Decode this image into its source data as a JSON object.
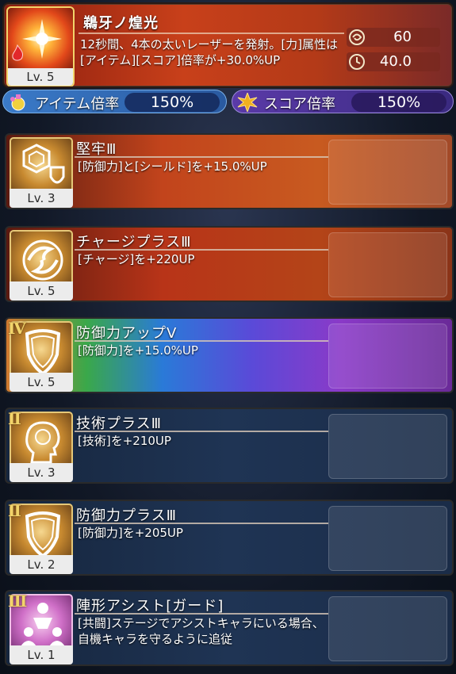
{
  "main_skill": {
    "title": "鵜牙ノ煌光",
    "level": "Lv. 5",
    "description": "12秒間、4本の太いレーザーを発射。[力]属性は[アイテム][スコア]倍率が+30.0%UP",
    "stat_charge": "60",
    "stat_time": "40.0",
    "icon": "flare-icon"
  },
  "multipliers": {
    "item_label": "アイテム倍率",
    "item_value": "150%",
    "score_label": "スコア倍率",
    "score_value": "150%"
  },
  "skills": [
    {
      "roman": "",
      "title": "堅牢Ⅲ",
      "desc": "[防御力]と[シールド]を+15.0%UP",
      "level": "Lv. 3",
      "icon": "hexagon-shield-icon"
    },
    {
      "roman": "",
      "title": "チャージプラスⅢ",
      "desc": "[チャージ]を+220UP",
      "level": "Lv. 5",
      "icon": "swirl-icon"
    },
    {
      "roman": "Ⅳ",
      "title": "防御力アップⅤ",
      "desc": "[防御力]を+15.0%UP",
      "level": "Lv. 5",
      "icon": "shield-icon"
    },
    {
      "roman": "Ⅱ",
      "title": "技術プラスⅢ",
      "desc": "[技術]を+210UP",
      "level": "Lv. 3",
      "icon": "head-icon"
    },
    {
      "roman": "Ⅱ",
      "title": "防御力プラスⅢ",
      "desc": "[防御力]を+205UP",
      "level": "Lv. 2",
      "icon": "shield-icon"
    },
    {
      "roman": "Ⅲ",
      "title": "陣形アシスト[ガード]",
      "desc": "[共闘]ステージでアシストキャラにいる場合、自機キャラを守るように追従",
      "level": "Lv. 1",
      "icon": "formation-icon"
    }
  ]
}
